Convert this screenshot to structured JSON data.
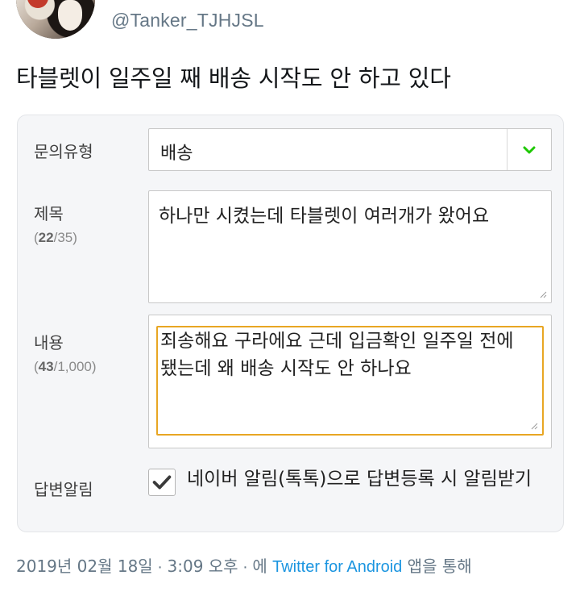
{
  "tweet": {
    "handle": "@Tanker_TJHJSL",
    "text": "타블렛이 일주일 째 배송 시작도 안 하고 있다"
  },
  "form": {
    "type_label": "문의유형",
    "type_value": "배송",
    "title_label": "제목",
    "title_count": "22",
    "title_max": "/35)",
    "title_open": "(",
    "title_text": "하나만 시켰는데 타블렛이 여러개가 왔어요",
    "content_label": "내용",
    "content_count": "43",
    "content_max": "/1,000)",
    "content_open": "(",
    "content_text": "죄송해요 구라에요 근데 입금확인 일주일 전에 됐는데 왜 배송 시작도 안 하나요",
    "notify_label": "답변알림",
    "notify_text": "네이버 알림(톡톡)으로 답변등록 시 알림받기",
    "notify_checked": true
  },
  "footer": {
    "date": "2019년 02월 18일",
    "sep1": " · ",
    "time": "3:09 오후",
    "sep2": " · ",
    "via_prefix": "에 ",
    "client": "Twitter for Android",
    "via_suffix": " 앱을 통해"
  },
  "colors": {
    "accent_green": "#1ec800",
    "focus_border": "#e8a623",
    "link": "#1b95e0"
  }
}
